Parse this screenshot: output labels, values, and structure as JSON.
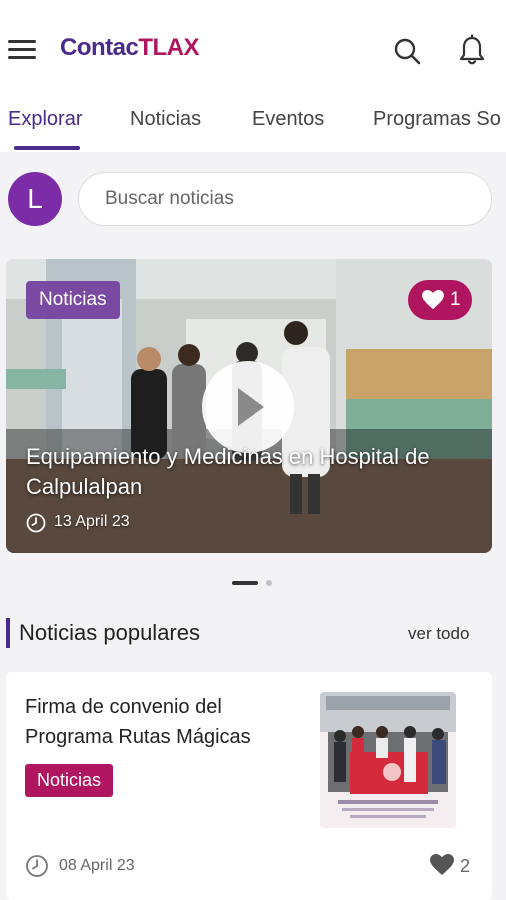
{
  "app": {
    "logo_part1": "Contac",
    "logo_part2": "TLAX"
  },
  "tabs": [
    {
      "label": "Explorar",
      "active": true
    },
    {
      "label": "Noticias"
    },
    {
      "label": "Eventos"
    },
    {
      "label": "Programas So"
    }
  ],
  "user": {
    "initial": "L"
  },
  "search": {
    "placeholder": "Buscar noticias"
  },
  "featured": {
    "category": "Noticias",
    "likes": "1",
    "title": "Equipamiento y Medicinas en Hospital de Calpulalpan",
    "date": "13 April 23"
  },
  "carousel": {
    "total": 2,
    "active": 0
  },
  "popular": {
    "section_title": "Noticias populares",
    "see_all": "ver todo",
    "items": [
      {
        "title": "Firma de convenio del Programa Rutas Mágicas",
        "category": "Noticias",
        "date": "08 April 23",
        "likes": "2"
      }
    ]
  },
  "colors": {
    "brand_purple": "#4a2a8a",
    "brand_magenta": "#b0165f",
    "avatar": "#7b2ca6",
    "badge_purple": "#7a4aa3"
  },
  "icons": [
    "menu-icon",
    "search-icon",
    "bell-icon",
    "heart-icon",
    "play-icon",
    "clock-icon"
  ]
}
